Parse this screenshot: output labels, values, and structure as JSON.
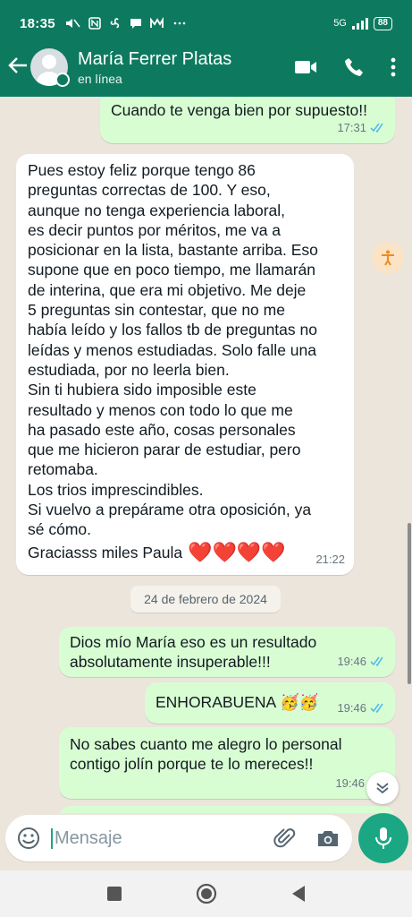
{
  "status_bar": {
    "time": "18:35",
    "network": "5G",
    "battery": "88"
  },
  "header": {
    "contact_name": "María Ferrer Platas",
    "presence": "en línea"
  },
  "messages": [
    {
      "direction": "out",
      "text": "Cuando te venga bien por supuesto!!",
      "time": "17:31",
      "ticks": "read"
    },
    {
      "direction": "in",
      "text": "Pues estoy feliz porque tengo 86\npreguntas correctas de 100. Y eso,\naunque no tenga experiencia laboral,\nes decir puntos por méritos, me va a\nposicionar en la lista, bastante arriba. Eso\nsupone que en poco tiempo, me llamarán\nde interina, que era mi objetivo. Me deje\n5 preguntas sin contestar, que no me\nhabía leído y los fallos tb de preguntas no\nleídas y menos estudiadas. Solo falle una\nestudiada, por no leerla bien.\nSin ti hubiera sido imposible este\nresultado y menos con todo lo que me\nha pasado este año, cosas personales\nque me hicieron parar de estudiar, pero\nretomaba.\nLos trios imprescindibles.\nSi vuelvo a prepárame otra oposición, ya\nsé cómo.",
      "closing": "Graciasss miles Paula",
      "closing_emoji": "❤️❤️❤️❤️",
      "time": "21:22"
    },
    {
      "direction": "out",
      "text": "Dios mío María eso es un resultado\nabsolutamente insuperable!!!",
      "time": "19:46",
      "ticks": "read"
    },
    {
      "direction": "out",
      "text": "ENHORABUENA",
      "emoji": "🥳🥳",
      "time": "19:46",
      "ticks": "read"
    },
    {
      "direction": "out",
      "text": "No sabes cuanto me alegro lo personal\ncontigo jolín porque te lo mereces!!",
      "time": "19:46"
    }
  ],
  "date_divider": "24 de febrero de 2024",
  "composer": {
    "placeholder": "Mensaje"
  },
  "colors": {
    "header": "#0d7a5f",
    "outgoing_bubble": "#d9fdd3",
    "incoming_bubble": "#ffffff",
    "mic_button": "#1ba784",
    "read_ticks": "#53bdeb",
    "hearts": "#e8202a"
  },
  "icons": [
    "back-arrow-icon",
    "video-call-icon",
    "phone-icon",
    "more-options-icon",
    "emoji-icon",
    "attach-icon",
    "camera-icon",
    "mic-icon",
    "scroll-down-icon",
    "accessibility-icon"
  ]
}
